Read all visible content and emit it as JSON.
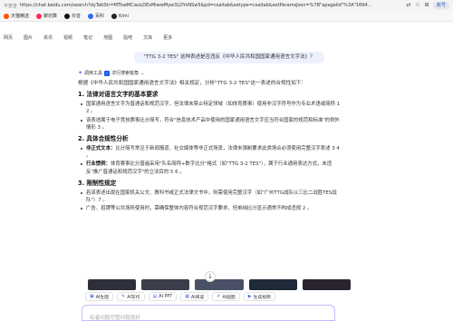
{
  "browser": {
    "insecure_label": "不安全",
    "url": "https://chat.baidu.com/search?dyTabStr=MTkwMCwzLDEsMiwwMyw3LDYsNSw5&pd=csaitab&setype=csaitab&extParamsJson=%7B\"apagelid\"%3A\"1694...",
    "profile_label": "账号"
  },
  "bookmarks": [
    {
      "label": "天猫精选",
      "color": "#ff5000"
    },
    {
      "label": "聚划算",
      "color": "#ff2b5a"
    },
    {
      "label": "抖音",
      "color": "#111111"
    },
    {
      "label": "百科",
      "color": "#2e66ff"
    },
    {
      "label": "Kimi",
      "color": "#222222"
    }
  ],
  "site_nav": [
    "网页",
    "图片",
    "资讯",
    "视频",
    "笔记",
    "地图",
    "贴吧",
    "文库",
    "更多"
  ],
  "query": "\"TTG 3-2 TES\" 这种表述是否违反《中华人民共和国国家通用语言文字法》？",
  "answer": {
    "tool_label": "调用工具",
    "tool_name": "法行搜索锐角",
    "intro": "根据《中华人民共和国国家通用语言文字法》相关规定，分析\"TTG 3-2 TES\"这一表述的合规性如下：",
    "sections": [
      {
        "heading": "1. 法律对语言文字的基本要求",
        "bullets": [
          {
            "bold": "",
            "text": "国家通用语言文字为普通话和规范汉字，但法律未禁止特定领域（如体育赛事）使用非汉字符号作为专业术语或简称 1 2 。"
          },
          {
            "bold": "",
            "text": "该表述属于电子竞技赛事比分简写，符合\"信息技术产品中使用的国家通用语言文字应当符合国家的规范和标准\"的例外情形 3 。"
          }
        ]
      },
      {
        "heading": "2. 具体合规性分析",
        "bullets": [
          {
            "bold": "非正式文本：",
            "text": "比分简写常见于新闻报道、社交媒体等非正式场景，法律未强制要求此类场合必须使用完整汉字表述 3 4 。"
          },
          {
            "bold": "行业惯例：",
            "text": "体育赛事比分普遍采用\"队名简称+数字比分\"格式（如\"TTG 3-2 TES\"），属于行业通用表达方式，未违反\"推广普通话和规范汉字\"的立法目的 5 6 。"
          }
        ]
      },
      {
        "heading": "3. 限制性规定",
        "bullets": [
          {
            "bold": "",
            "text": "若该表述出现在国家机关公文、教科书或正式法律文书中，则需使用完整汉字（如\"广州TTG战队以三比二战胜TES战队\"）7 。"
          },
          {
            "bold": "",
            "text": "广告、招牌等公共场所使用时，需确保整体内容符合规范汉字要求，但单纯比分显示通常不构成违规 2 。"
          }
        ]
      }
    ]
  },
  "thumb_colors": [
    "#2d2f3a",
    "#3a3d4a",
    "#4a5166",
    "#1f2a38",
    "#2b2430"
  ],
  "chips": [
    {
      "icon": "image-icon",
      "glyph": "▣",
      "label": "AI生图"
    },
    {
      "icon": "pen-icon",
      "glyph": "✎",
      "label": "AI写作"
    },
    {
      "icon": "ppt-icon",
      "glyph": "▤",
      "label": "AI PPT"
    },
    {
      "icon": "read-icon",
      "glyph": "▦",
      "label": "AI阅读"
    },
    {
      "icon": "draw-icon",
      "glyph": "✐",
      "label": "AI画图"
    },
    {
      "icon": "video-icon",
      "glyph": "▶",
      "label": "生成视频"
    }
  ],
  "input": {
    "placeholder": "有者问题尽管问我就好"
  }
}
